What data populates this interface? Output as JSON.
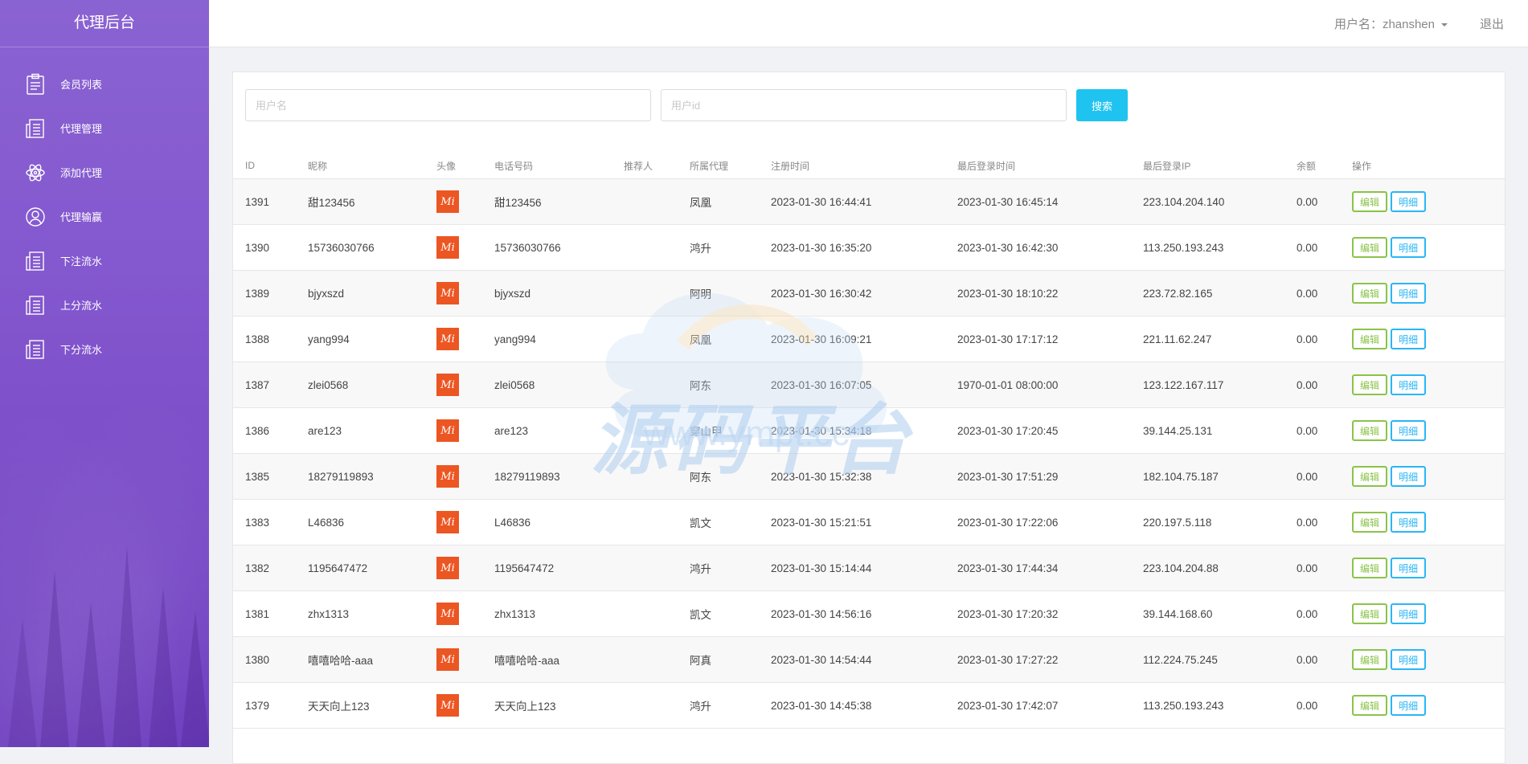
{
  "brand": "代理后台",
  "sidebar": {
    "items": [
      {
        "label": "会员列表",
        "icon": "clipboard-icon"
      },
      {
        "label": "代理管理",
        "icon": "ledger-icon"
      },
      {
        "label": "添加代理",
        "icon": "atom-icon"
      },
      {
        "label": "代理输赢",
        "icon": "user-circle-icon"
      },
      {
        "label": "下注流水",
        "icon": "ledger-icon"
      },
      {
        "label": "上分流水",
        "icon": "ledger-icon"
      },
      {
        "label": "下分流水",
        "icon": "ledger-icon"
      }
    ]
  },
  "header": {
    "user_label": "用户名：zhanshen",
    "logout": "退出"
  },
  "search": {
    "username_placeholder": "用户名",
    "userid_placeholder": "用户id",
    "button": "搜索"
  },
  "table": {
    "columns": [
      "ID",
      "昵称",
      "头像",
      "电话号码",
      "推荐人",
      "所属代理",
      "注册时间",
      "最后登录时间",
      "最后登录IP",
      "余额",
      "操作"
    ],
    "edit_label": "编辑",
    "detail_label": "明细",
    "avatar_text": "Mi",
    "rows": [
      {
        "id": "1391",
        "nick": "甜123456",
        "phone": "甜123456",
        "referrer": "",
        "agent": "凤凰",
        "reg": "2023-01-30 16:44:41",
        "last": "2023-01-30 16:45:14",
        "ip": "223.104.204.140",
        "balance": "0.00"
      },
      {
        "id": "1390",
        "nick": "15736030766",
        "phone": "15736030766",
        "referrer": "",
        "agent": "鸿升",
        "reg": "2023-01-30 16:35:20",
        "last": "2023-01-30 16:42:30",
        "ip": "113.250.193.243",
        "balance": "0.00"
      },
      {
        "id": "1389",
        "nick": "bjyxszd",
        "phone": "bjyxszd",
        "referrer": "",
        "agent": "阿明",
        "reg": "2023-01-30 16:30:42",
        "last": "2023-01-30 18:10:22",
        "ip": "223.72.82.165",
        "balance": "0.00"
      },
      {
        "id": "1388",
        "nick": "yang994",
        "phone": "yang994",
        "referrer": "",
        "agent": "凤凰",
        "reg": "2023-01-30 16:09:21",
        "last": "2023-01-30 17:17:12",
        "ip": "221.11.62.247",
        "balance": "0.00"
      },
      {
        "id": "1387",
        "nick": "zlei0568",
        "phone": "zlei0568",
        "referrer": "",
        "agent": "阿东",
        "reg": "2023-01-30 16:07:05",
        "last": "1970-01-01 08:00:00",
        "ip": "123.122.167.117",
        "balance": "0.00"
      },
      {
        "id": "1386",
        "nick": "are123",
        "phone": "are123",
        "referrer": "",
        "agent": "穿山甲",
        "reg": "2023-01-30 15:34:18",
        "last": "2023-01-30 17:20:45",
        "ip": "39.144.25.131",
        "balance": "0.00"
      },
      {
        "id": "1385",
        "nick": "18279119893",
        "phone": "18279119893",
        "referrer": "",
        "agent": "阿东",
        "reg": "2023-01-30 15:32:38",
        "last": "2023-01-30 17:51:29",
        "ip": "182.104.75.187",
        "balance": "0.00"
      },
      {
        "id": "1383",
        "nick": "L46836",
        "phone": "L46836",
        "referrer": "",
        "agent": "凯文",
        "reg": "2023-01-30 15:21:51",
        "last": "2023-01-30 17:22:06",
        "ip": "220.197.5.118",
        "balance": "0.00"
      },
      {
        "id": "1382",
        "nick": "1195647472",
        "phone": "1195647472",
        "referrer": "",
        "agent": "鸿升",
        "reg": "2023-01-30 15:14:44",
        "last": "2023-01-30 17:44:34",
        "ip": "223.104.204.88",
        "balance": "0.00"
      },
      {
        "id": "1381",
        "nick": "zhx1313",
        "phone": "zhx1313",
        "referrer": "",
        "agent": "凯文",
        "reg": "2023-01-30 14:56:16",
        "last": "2023-01-30 17:20:32",
        "ip": "39.144.168.60",
        "balance": "0.00"
      },
      {
        "id": "1380",
        "nick": "嘻嘻哈哈-aaa",
        "phone": "嘻嘻哈哈-aaa",
        "referrer": "",
        "agent": "阿真",
        "reg": "2023-01-30 14:54:44",
        "last": "2023-01-30 17:27:22",
        "ip": "112.224.75.245",
        "balance": "0.00"
      },
      {
        "id": "1379",
        "nick": "天天向上123",
        "phone": "天天向上123",
        "referrer": "",
        "agent": "鸿升",
        "reg": "2023-01-30 14:45:38",
        "last": "2023-01-30 17:42:07",
        "ip": "113.250.193.243",
        "balance": "0.00"
      }
    ]
  },
  "watermark": {
    "title": "源码平台",
    "url": "www.ympt.cc"
  }
}
